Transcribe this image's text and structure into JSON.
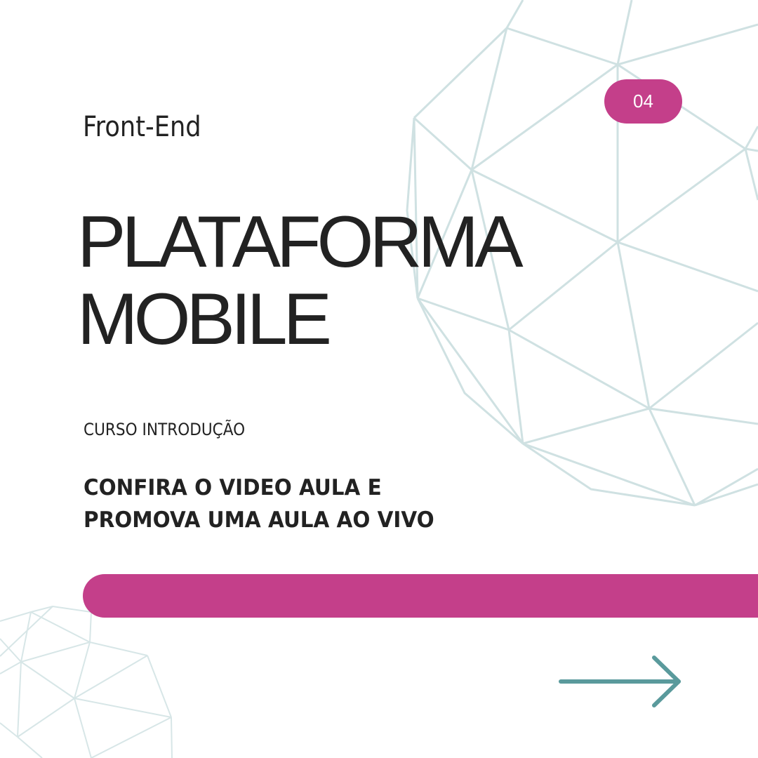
{
  "header": {
    "category": "Front-End",
    "page_number": "04"
  },
  "main": {
    "title_line1": "PLATAFORMA",
    "title_line2": "MOBILE",
    "course_label": "CURSO INTRODUÇÃO",
    "cta_line1": "CONFIRA O VIDEO AULA E",
    "cta_line2": "PROMOVA UMA AULA AO VIVO"
  },
  "icons": {
    "next": "arrow-right-icon",
    "decoration": "geodesic-sphere-outline"
  },
  "colors": {
    "accent": "#c43f8a",
    "arrow": "#5a9a9c",
    "wireframe": "#cfe1e2",
    "text": "#222222",
    "background": "#ffffff"
  }
}
